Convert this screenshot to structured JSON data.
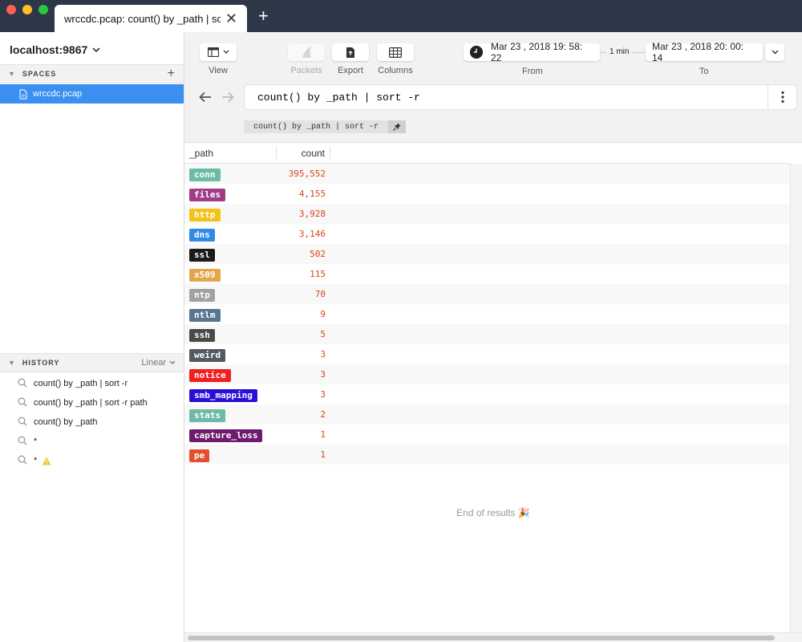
{
  "window": {
    "tab_title": "wrccdc.pcap: count() by _path | so...",
    "tab_close": "✕",
    "new_tab": "+"
  },
  "sidebar": {
    "host": "localhost:9867",
    "spaces_header": "SPACES",
    "add": "+",
    "space_item": "wrccdc.pcap",
    "history_header": "HISTORY",
    "history_mode": "Linear",
    "history": [
      "count() by _path | sort -r",
      "count() by _path | sort -r path",
      "count() by _path",
      "*",
      "*"
    ]
  },
  "toolbar": {
    "view_label": "View",
    "packets_label": "Packets",
    "export_label": "Export",
    "columns_label": "Columns",
    "from_label": "From",
    "to_label": "To",
    "from_value": "Mar 23 , 2018  19: 58: 22",
    "duration": "1 min",
    "to_value": "Mar 23 , 2018  20: 00: 14"
  },
  "search": {
    "value": "count() by _path | sort -r",
    "pinned": "count() by _path | sort -r"
  },
  "table": {
    "headers": [
      "_path",
      "count"
    ],
    "rows": [
      {
        "path": "conn",
        "count": "395,552",
        "color": "#6cbba6"
      },
      {
        "path": "files",
        "count": "4,155",
        "color": "#a13b87"
      },
      {
        "path": "http",
        "count": "3,928",
        "color": "#f4c21a"
      },
      {
        "path": "dns",
        "count": "3,146",
        "color": "#2f8ae8"
      },
      {
        "path": "ssl",
        "count": "502",
        "color": "#1b1b1b"
      },
      {
        "path": "x509",
        "count": "115",
        "color": "#e3a74b"
      },
      {
        "path": "ntp",
        "count": "70",
        "color": "#a2a2a2"
      },
      {
        "path": "ntlm",
        "count": "9",
        "color": "#5a7593"
      },
      {
        "path": "ssh",
        "count": "5",
        "color": "#4a4a4a"
      },
      {
        "path": "weird",
        "count": "3",
        "color": "#535a63"
      },
      {
        "path": "notice",
        "count": "3",
        "color": "#f21f1f"
      },
      {
        "path": "smb_mapping",
        "count": "3",
        "color": "#2a0ed9"
      },
      {
        "path": "stats",
        "count": "2",
        "color": "#6cbba6"
      },
      {
        "path": "capture_loss",
        "count": "1",
        "color": "#6e1b6e"
      },
      {
        "path": "pe",
        "count": "1",
        "color": "#e0502f"
      }
    ]
  },
  "end_of_results": "End of results 🎉"
}
